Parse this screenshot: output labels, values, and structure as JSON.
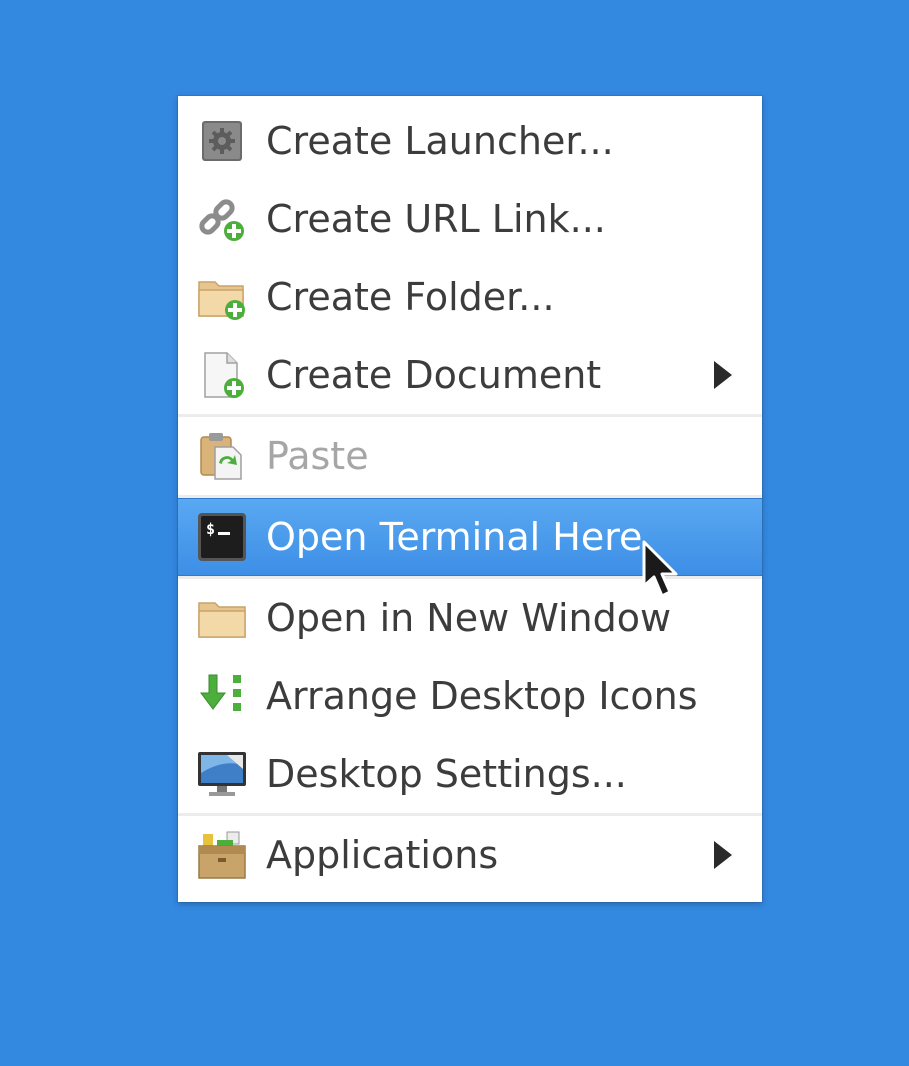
{
  "menu": {
    "items": [
      {
        "label": "Create Launcher...",
        "icon": "launcher-gear-icon"
      },
      {
        "label": "Create URL Link...",
        "icon": "url-link-icon"
      },
      {
        "label": "Create Folder...",
        "icon": "folder-add-icon"
      },
      {
        "label": "Create Document",
        "icon": "document-add-icon",
        "submenu": true
      },
      {
        "label": "Paste",
        "icon": "paste-icon",
        "disabled": true
      },
      {
        "label": "Open Terminal Here",
        "icon": "terminal-icon",
        "highlighted": true
      },
      {
        "label": "Open in New Window",
        "icon": "folder-icon"
      },
      {
        "label": "Arrange Desktop Icons",
        "icon": "arrange-icon"
      },
      {
        "label": "Desktop Settings...",
        "icon": "monitor-icon"
      },
      {
        "label": "Applications",
        "icon": "applications-icon",
        "submenu": true
      }
    ]
  },
  "colors": {
    "desktop": "#3388e0",
    "highlight": "#4a9cee",
    "text": "#3c3c3c",
    "disabled_text": "#a6a6a6"
  }
}
